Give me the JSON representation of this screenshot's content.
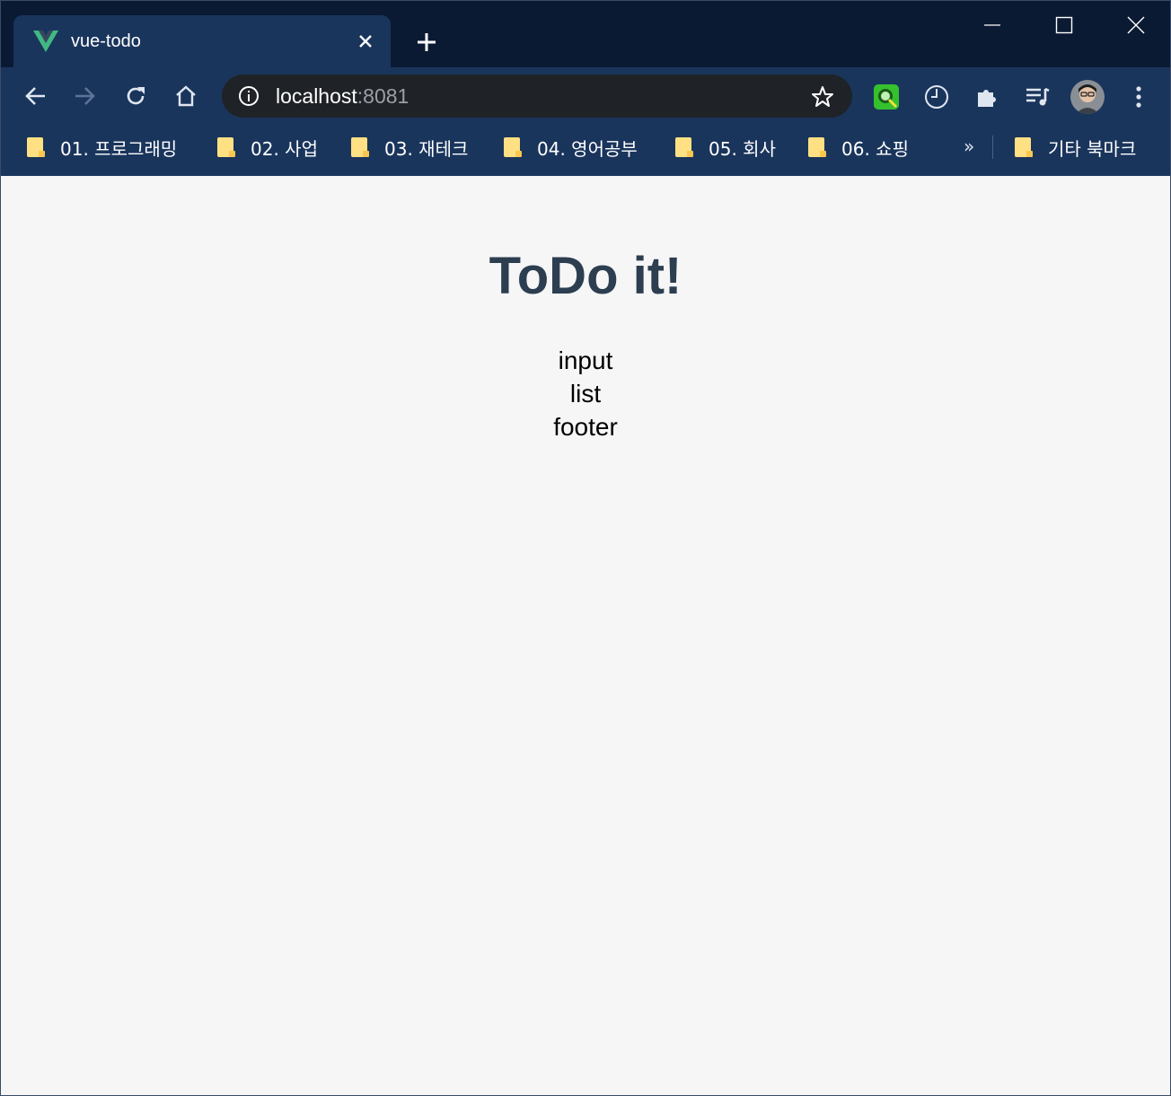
{
  "browser": {
    "tab": {
      "title": "vue-todo",
      "favicon": "vue-logo-icon"
    },
    "window_controls": [
      "minimize-icon",
      "maximize-icon",
      "close-icon"
    ],
    "omnibox": {
      "host": "localhost",
      "port": ":8081"
    },
    "bookmarks": [
      {
        "label": "01. 프로그래밍"
      },
      {
        "label": "02. 사업"
      },
      {
        "label": "03. 재테크"
      },
      {
        "label": "04. 영어공부"
      },
      {
        "label": "05. 회사"
      },
      {
        "label": "06. 쇼핑"
      }
    ],
    "bookmarks_overflow": "»",
    "other_bookmarks": "기타 북마크"
  },
  "page": {
    "title": "ToDo it!",
    "components": [
      "input",
      "list",
      "footer"
    ]
  },
  "colors": {
    "frame": "#0b1a33",
    "toolbar": "#1a355c",
    "page_bg": "#f6f6f6",
    "title": "#2c3e50"
  }
}
